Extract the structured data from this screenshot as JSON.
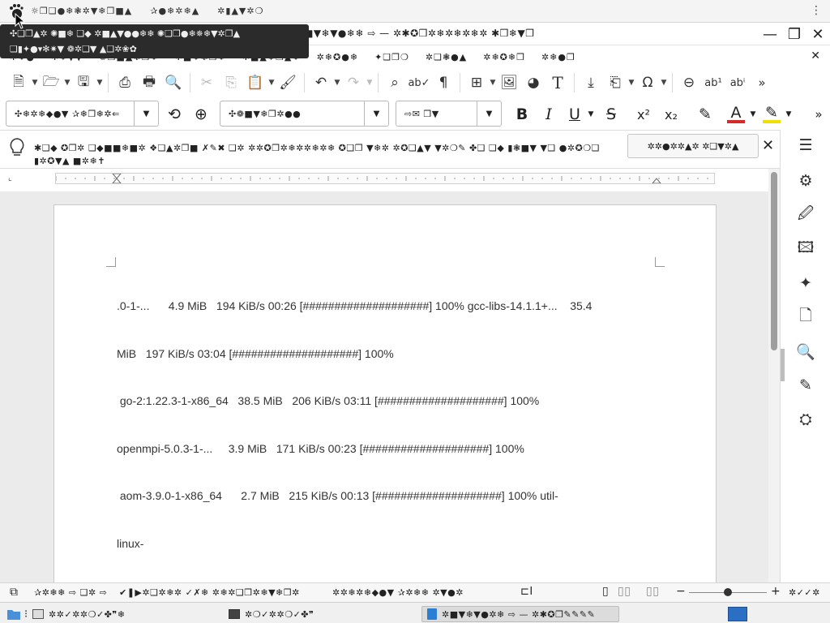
{
  "top_panel": {
    "app_icon": "gnome-foot-icon",
    "menus": [
      "☼❒❑●❄❃✲▼❄❒■▲",
      "✰●❄✲❄▲",
      "✲▮▲▼✲❍"
    ],
    "grip": "⋮"
  },
  "tooltip": {
    "line1": "✣❑❒▲✲ ✺■❄ ❑◆ ✲■▲▼●●❄❄ ✺❑❒●❄✵❄▼✲❒▲",
    "line2": "❑▮✦●▾✻✷▼ ❁✲❑▼ ▲❑✲❀✿"
  },
  "window": {
    "title": "✱■▼❄▼●❄❄ ⇨ — ✲✱✪❒✲❄✲❄✲❄✲ ✱❒❄▼❒",
    "minimize": "—",
    "maximize": "❐",
    "close": "✕"
  },
  "menubar": {
    "items": [
      "✲❄●",
      "✲❄▼▼",
      "✺❒■▲❃❒❄",
      "✲■❄❃❒❄",
      "✲■▲❄❒▲❄",
      "✲❄✪●❄",
      "✦❑❒❍",
      "✲❑❃●▲",
      "✲❄✪❄❒",
      "✲❄●❒"
    ],
    "close": "✕"
  },
  "toolbar": {
    "buttons": [
      {
        "icon": "new-document-icon",
        "glyph": "🗎",
        "dropdown": true
      },
      {
        "icon": "open-folder-icon",
        "glyph": "🗁",
        "dropdown": true
      },
      {
        "icon": "save-icon",
        "glyph": "🖫",
        "dropdown": true
      },
      {
        "icon": "export-pdf-icon",
        "glyph": "⎙"
      },
      {
        "icon": "print-icon",
        "glyph": "🖶"
      },
      {
        "icon": "print-preview-icon",
        "glyph": "🔍"
      },
      {
        "icon": "cut-icon",
        "glyph": "✂",
        "disabled": true
      },
      {
        "icon": "copy-icon",
        "glyph": "⎘",
        "disabled": true
      },
      {
        "icon": "paste-icon",
        "glyph": "📋",
        "dropdown": true
      },
      {
        "icon": "clone-formatting-icon",
        "glyph": "🖌"
      },
      {
        "icon": "undo-icon",
        "glyph": "↶",
        "dropdown": true
      },
      {
        "icon": "redo-icon",
        "glyph": "↷",
        "dropdown": true,
        "disabled": true
      },
      {
        "icon": "find-replace-icon",
        "glyph": "⌕"
      },
      {
        "icon": "spelling-icon",
        "glyph": "ab✓"
      },
      {
        "icon": "formatting-marks-icon",
        "glyph": "¶"
      },
      {
        "icon": "insert-table-icon",
        "glyph": "⊞",
        "dropdown": true
      },
      {
        "icon": "insert-image-icon",
        "glyph": "🖼"
      },
      {
        "icon": "insert-chart-icon",
        "glyph": "◕"
      },
      {
        "icon": "insert-textbox-icon",
        "glyph": "T"
      },
      {
        "icon": "page-break-icon",
        "glyph": "⤓"
      },
      {
        "icon": "insert-field-icon",
        "glyph": "⎗",
        "dropdown": true
      },
      {
        "icon": "special-character-icon",
        "glyph": "Ω",
        "dropdown": true
      },
      {
        "icon": "insert-link-icon",
        "glyph": "⊖"
      },
      {
        "icon": "footnote-icon",
        "glyph": "ab¹"
      },
      {
        "icon": "endnote-icon",
        "glyph": "abⁱ"
      },
      {
        "icon": "more-icon",
        "glyph": "»"
      }
    ]
  },
  "format_bar": {
    "paragraph_style": "✣❄✲❄◆●▼ ✰❄❒❄✲⇐",
    "font_name": "✣❁■▼❄❒✲●●",
    "font_size": "⇨✉ ❒▼",
    "bold": "B",
    "italic": "I",
    "underline": "U",
    "strikethrough": "S",
    "superscript": "x²",
    "subscript": "x₂",
    "clear": "✎",
    "font_color": "A",
    "highlight": "✎",
    "more": "»",
    "font_color_hex": "#d42a2a",
    "highlight_hex": "#f0e000"
  },
  "infobar": {
    "message": "✱❑◆ ✪❒✲ ❑◆■■❄■✲ ❖❑▲✲❒■ ✗✎✖ ❑✲ ✲✲✪❒✲❄✲✲❄✲❄ ✪❑❒ ▼❄✲ ✲✪❑▲▼ ▼✲❍✎ ✤❑ ❑◆ ▮❃■▼ ▼❑ ●✲✪❍❑ ▮✲✪▼▲ ■✲❄✝",
    "button": "✲✲●✲✲▲✲ ✲❑▼✲▲",
    "close": "✕"
  },
  "document": {
    "lines": [
      ".0-1-...      4.9 MiB   194 KiB/s 00:26 [####################] 100% gcc-libs-14.1.1+...    35.4",
      "MiB   197 KiB/s 03:04 [####################] 100%",
      " go-2:1.22.3-1-x86_64   38.5 MiB   206 KiB/s 03:11 [####################] 100%",
      "openmpi-5.0.3-1-...     3.9 MiB   171 KiB/s 00:23 [####################] 100%",
      " aom-3.9.0-1-x86_64      2.7 MiB   215 KiB/s 00:13 [####################] 100% util-",
      "linux-"
    ]
  },
  "sidebar": {
    "buttons": [
      {
        "icon": "sidebar-menu-icon",
        "glyph": "☰"
      },
      {
        "icon": "properties-icon",
        "glyph": "⚙"
      },
      {
        "icon": "styles-icon",
        "glyph": "🖉"
      },
      {
        "icon": "gallery-icon",
        "glyph": "🖾"
      },
      {
        "icon": "navigator-icon",
        "glyph": "✦"
      },
      {
        "icon": "page-icon",
        "glyph": "🗋"
      },
      {
        "icon": "style-inspector-icon",
        "glyph": "🔍"
      },
      {
        "icon": "manage-changes-icon",
        "glyph": "✎"
      },
      {
        "icon": "design-icon",
        "glyph": "⛭"
      }
    ]
  },
  "statusbar": {
    "page_info": "✰✲❄❄ ⇨ ❑✲ ⇨",
    "word_count": "✔❚▶✲❑✲❄✲ ✓✗❄ ✲❄✲❑❒✲❄▼❄❒✲",
    "page_style": "✲✲❄✲❄◆●▼ ✰✲❄❄ ✲▼●✲",
    "insert_mode": "⊏I",
    "zoom_minus": "−",
    "zoom_plus": "+",
    "zoom_level": "✲✓✓✲"
  },
  "taskbar": {
    "tasks": [
      {
        "icon": "files-icon",
        "label": "",
        "active": false
      },
      {
        "icon": "terminal-icon",
        "label": "✲✲✓✲✲❍✓✤❞❄",
        "active": false
      },
      {
        "icon": "terminal-icon",
        "label": "✲❍✓✲✲❍✓✤❞",
        "active": false
      },
      {
        "icon": "writer-document-icon",
        "label": "✲■▼❄▼●✲❄ ⇨ — ✲✱✪❒✎✎✎✎",
        "active": true
      }
    ],
    "tray": "tray-icon"
  }
}
